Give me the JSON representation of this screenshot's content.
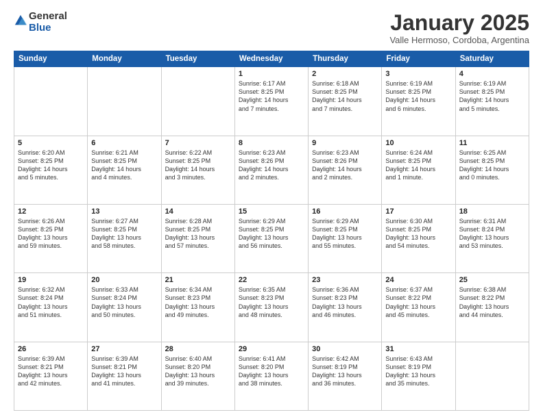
{
  "logo": {
    "general": "General",
    "blue": "Blue"
  },
  "header": {
    "month": "January 2025",
    "location": "Valle Hermoso, Cordoba, Argentina"
  },
  "weekdays": [
    "Sunday",
    "Monday",
    "Tuesday",
    "Wednesday",
    "Thursday",
    "Friday",
    "Saturday"
  ],
  "weeks": [
    [
      {
        "day": "",
        "info": ""
      },
      {
        "day": "",
        "info": ""
      },
      {
        "day": "",
        "info": ""
      },
      {
        "day": "1",
        "info": "Sunrise: 6:17 AM\nSunset: 8:25 PM\nDaylight: 14 hours\nand 7 minutes."
      },
      {
        "day": "2",
        "info": "Sunrise: 6:18 AM\nSunset: 8:25 PM\nDaylight: 14 hours\nand 7 minutes."
      },
      {
        "day": "3",
        "info": "Sunrise: 6:19 AM\nSunset: 8:25 PM\nDaylight: 14 hours\nand 6 minutes."
      },
      {
        "day": "4",
        "info": "Sunrise: 6:19 AM\nSunset: 8:25 PM\nDaylight: 14 hours\nand 5 minutes."
      }
    ],
    [
      {
        "day": "5",
        "info": "Sunrise: 6:20 AM\nSunset: 8:25 PM\nDaylight: 14 hours\nand 5 minutes."
      },
      {
        "day": "6",
        "info": "Sunrise: 6:21 AM\nSunset: 8:25 PM\nDaylight: 14 hours\nand 4 minutes."
      },
      {
        "day": "7",
        "info": "Sunrise: 6:22 AM\nSunset: 8:25 PM\nDaylight: 14 hours\nand 3 minutes."
      },
      {
        "day": "8",
        "info": "Sunrise: 6:23 AM\nSunset: 8:26 PM\nDaylight: 14 hours\nand 2 minutes."
      },
      {
        "day": "9",
        "info": "Sunrise: 6:23 AM\nSunset: 8:26 PM\nDaylight: 14 hours\nand 2 minutes."
      },
      {
        "day": "10",
        "info": "Sunrise: 6:24 AM\nSunset: 8:25 PM\nDaylight: 14 hours\nand 1 minute."
      },
      {
        "day": "11",
        "info": "Sunrise: 6:25 AM\nSunset: 8:25 PM\nDaylight: 14 hours\nand 0 minutes."
      }
    ],
    [
      {
        "day": "12",
        "info": "Sunrise: 6:26 AM\nSunset: 8:25 PM\nDaylight: 13 hours\nand 59 minutes."
      },
      {
        "day": "13",
        "info": "Sunrise: 6:27 AM\nSunset: 8:25 PM\nDaylight: 13 hours\nand 58 minutes."
      },
      {
        "day": "14",
        "info": "Sunrise: 6:28 AM\nSunset: 8:25 PM\nDaylight: 13 hours\nand 57 minutes."
      },
      {
        "day": "15",
        "info": "Sunrise: 6:29 AM\nSunset: 8:25 PM\nDaylight: 13 hours\nand 56 minutes."
      },
      {
        "day": "16",
        "info": "Sunrise: 6:29 AM\nSunset: 8:25 PM\nDaylight: 13 hours\nand 55 minutes."
      },
      {
        "day": "17",
        "info": "Sunrise: 6:30 AM\nSunset: 8:25 PM\nDaylight: 13 hours\nand 54 minutes."
      },
      {
        "day": "18",
        "info": "Sunrise: 6:31 AM\nSunset: 8:24 PM\nDaylight: 13 hours\nand 53 minutes."
      }
    ],
    [
      {
        "day": "19",
        "info": "Sunrise: 6:32 AM\nSunset: 8:24 PM\nDaylight: 13 hours\nand 51 minutes."
      },
      {
        "day": "20",
        "info": "Sunrise: 6:33 AM\nSunset: 8:24 PM\nDaylight: 13 hours\nand 50 minutes."
      },
      {
        "day": "21",
        "info": "Sunrise: 6:34 AM\nSunset: 8:23 PM\nDaylight: 13 hours\nand 49 minutes."
      },
      {
        "day": "22",
        "info": "Sunrise: 6:35 AM\nSunset: 8:23 PM\nDaylight: 13 hours\nand 48 minutes."
      },
      {
        "day": "23",
        "info": "Sunrise: 6:36 AM\nSunset: 8:23 PM\nDaylight: 13 hours\nand 46 minutes."
      },
      {
        "day": "24",
        "info": "Sunrise: 6:37 AM\nSunset: 8:22 PM\nDaylight: 13 hours\nand 45 minutes."
      },
      {
        "day": "25",
        "info": "Sunrise: 6:38 AM\nSunset: 8:22 PM\nDaylight: 13 hours\nand 44 minutes."
      }
    ],
    [
      {
        "day": "26",
        "info": "Sunrise: 6:39 AM\nSunset: 8:21 PM\nDaylight: 13 hours\nand 42 minutes."
      },
      {
        "day": "27",
        "info": "Sunrise: 6:39 AM\nSunset: 8:21 PM\nDaylight: 13 hours\nand 41 minutes."
      },
      {
        "day": "28",
        "info": "Sunrise: 6:40 AM\nSunset: 8:20 PM\nDaylight: 13 hours\nand 39 minutes."
      },
      {
        "day": "29",
        "info": "Sunrise: 6:41 AM\nSunset: 8:20 PM\nDaylight: 13 hours\nand 38 minutes."
      },
      {
        "day": "30",
        "info": "Sunrise: 6:42 AM\nSunset: 8:19 PM\nDaylight: 13 hours\nand 36 minutes."
      },
      {
        "day": "31",
        "info": "Sunrise: 6:43 AM\nSunset: 8:19 PM\nDaylight: 13 hours\nand 35 minutes."
      },
      {
        "day": "",
        "info": ""
      }
    ]
  ]
}
